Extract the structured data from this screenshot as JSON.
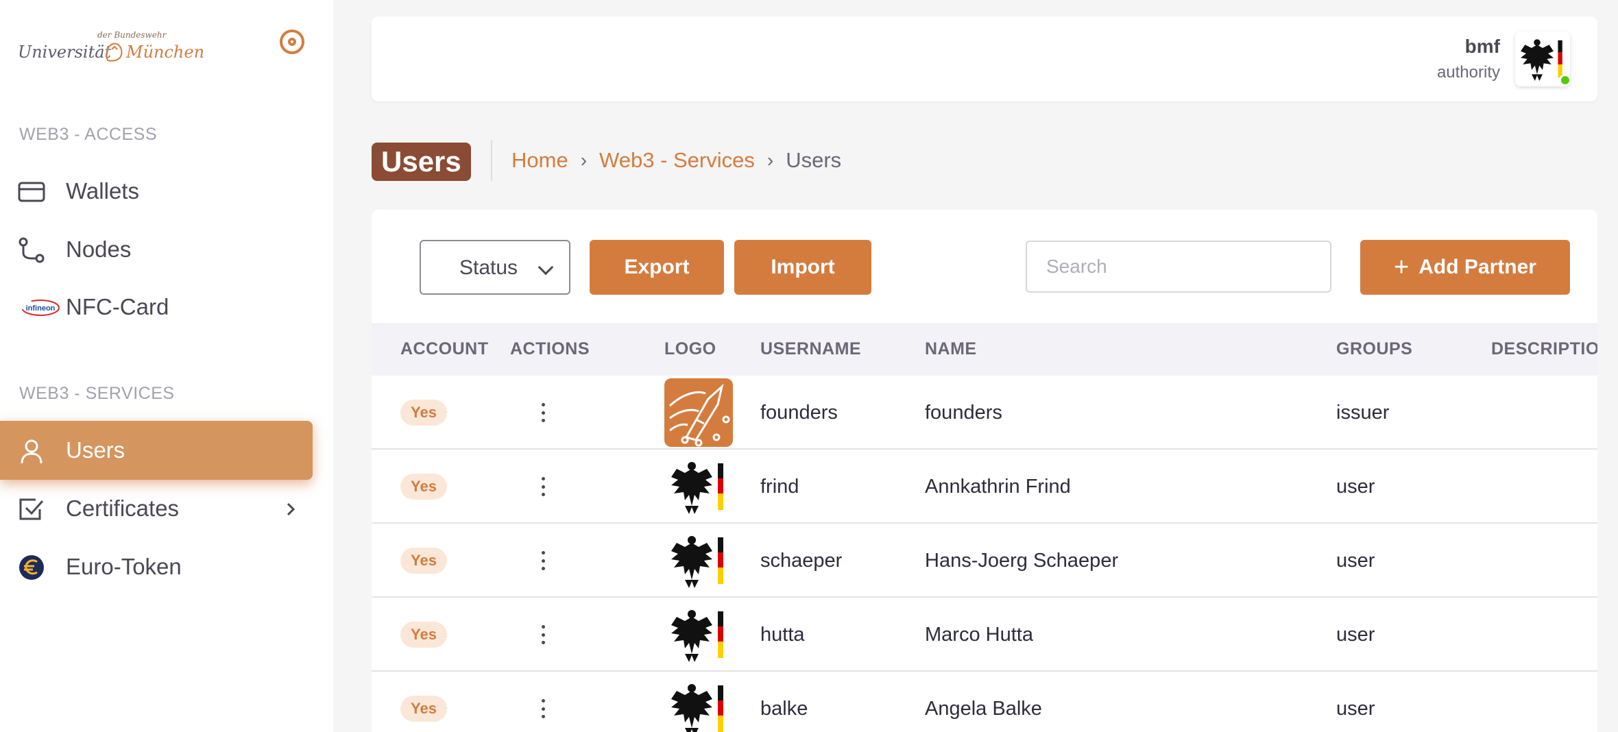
{
  "brand": {
    "line1": "Universität",
    "line_small": "der Bundeswehr",
    "line2": "München"
  },
  "sidebar": {
    "sections": [
      {
        "title": "WEB3 - ACCESS"
      },
      {
        "title": "WEB3 - SERVICES"
      }
    ],
    "items": [
      {
        "label": "Wallets",
        "icon": "credit-card-icon"
      },
      {
        "label": "Nodes",
        "icon": "route-icon"
      },
      {
        "label": "NFC-Card",
        "icon": "infineon-logo-icon"
      },
      {
        "label": "Users",
        "icon": "user-icon",
        "active": true
      },
      {
        "label": "Certificates",
        "icon": "checkbox-icon"
      },
      {
        "label": "Euro-Token",
        "icon": "euro-token-icon"
      }
    ],
    "infineon_text": "infineon"
  },
  "header": {
    "user_name": "bmf",
    "user_role": "authority"
  },
  "page": {
    "title": "Users",
    "breadcrumbs": [
      "Home",
      "Web3 - Services",
      "Users"
    ]
  },
  "toolbar": {
    "status_label": "Status",
    "export_label": "Export",
    "import_label": "Import",
    "search_placeholder": "Search",
    "add_label": "Add Partner"
  },
  "table": {
    "columns": [
      "ACCOUNT",
      "ACTIONS",
      "LOGO",
      "USERNAME",
      "NAME",
      "GROUPS",
      "DESCRIPTIO"
    ],
    "rows": [
      {
        "account": "Yes",
        "logo": "founders-rocket-logo",
        "username": "founders",
        "name": "founders",
        "group": "issuer"
      },
      {
        "account": "Yes",
        "logo": "federal-eagle-logo",
        "username": "frind",
        "name": "Annkathrin Frind",
        "group": "user"
      },
      {
        "account": "Yes",
        "logo": "federal-eagle-logo",
        "username": "schaeper",
        "name": "Hans-Joerg Schaeper",
        "group": "user"
      },
      {
        "account": "Yes",
        "logo": "federal-eagle-logo",
        "username": "hutta",
        "name": "Marco Hutta",
        "group": "user"
      },
      {
        "account": "Yes",
        "logo": "federal-eagle-logo",
        "username": "balke",
        "name": "Angela Balke",
        "group": "user"
      }
    ]
  },
  "colors": {
    "accent": "#d47c3e",
    "active_nav": "#d4955f",
    "title_badge": "#8a4c35",
    "online": "#56ca00"
  }
}
